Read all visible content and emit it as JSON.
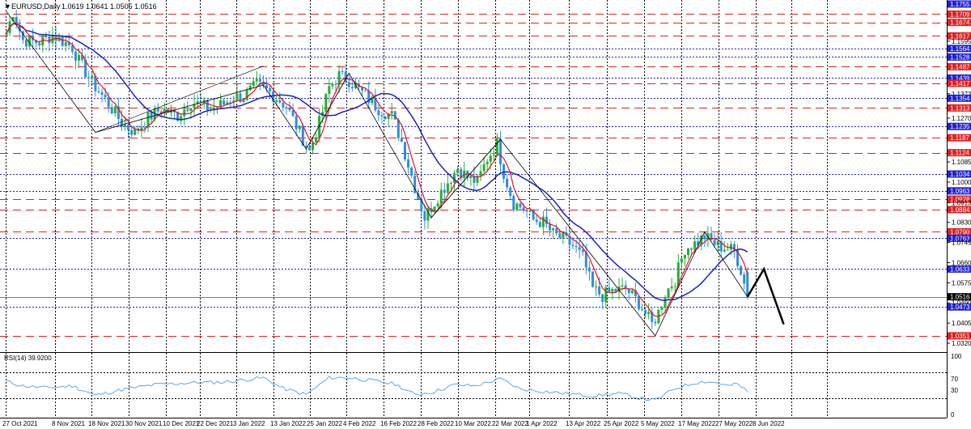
{
  "header": {
    "arrow": "▼",
    "title": "EURUSD,Daily",
    "ohlc": "1.0619 1.0641 1.0505 1.0516"
  },
  "rsi": {
    "label": "RSI(14) 39.9200",
    "levels": [
      "100",
      "70",
      "30",
      "0"
    ],
    "level_values": [
      70,
      30
    ]
  },
  "colors": {
    "bull": "#22b030",
    "bear": "#2e8fdc",
    "sma_fast": "#e8102a",
    "sma_slow": "#1a22c8",
    "rsi_line": "#5aa9e6",
    "support": "#2020d0",
    "resistance": "#e02020",
    "grid": "#000000"
  },
  "chart_data": {
    "type": "line",
    "title": "EURUSD,Daily",
    "y_axis_ticks": [
      "1.1755",
      "1.1709",
      "1.1674",
      "1.1617",
      "1.1595",
      "1.1564",
      "1.1528",
      "1.1487",
      "1.1439",
      "1.1417",
      "1.1373",
      "1.1354",
      "1.1313",
      "1.1270",
      "1.1235",
      "1.1187",
      "1.1124",
      "1.1085",
      "1.1034",
      "1.1000",
      "1.0963",
      "1.0928",
      "1.0913",
      "1.0884",
      "1.0830",
      "1.0790",
      "1.0763",
      "1.0745",
      "1.0660",
      "1.0633",
      "1.0575",
      "1.0516",
      "1.0490",
      "1.0473",
      "1.0405",
      "1.0351",
      "1.0320"
    ],
    "x_axis_ticks": [
      "27 Oct 2021",
      "8 Nov 2021",
      "18 Nov 2021",
      "30 Nov 2021",
      "10 Dec 2021",
      "22 Dec 2021",
      "3 Jan 2022",
      "13 Jan 2022",
      "25 Jan 2022",
      "4 Feb 2022",
      "16 Feb 2022",
      "28 Feb 2022",
      "10 Mar 2022",
      "22 Mar 2022",
      "1 Apr 2022",
      "13 Apr 2022",
      "25 Apr 2022",
      "5 May 2022",
      "17 May 2022",
      "27 May 2022",
      "8 Jun 2022"
    ],
    "ylim": [
      1.032,
      1.1755
    ],
    "support_levels": [
      {
        "value": "1.1564",
        "color": "#2020d0"
      },
      {
        "value": "1.1528",
        "color": "#2020d0"
      },
      {
        "value": "1.1439",
        "color": "#2020d0"
      },
      {
        "value": "1.1354",
        "color": "#2020d0"
      },
      {
        "value": "1.1235",
        "color": "#2020d0"
      },
      {
        "value": "1.1034",
        "color": "#2020d0"
      },
      {
        "value": "1.0963",
        "color": "#2020d0"
      },
      {
        "value": "1.0763",
        "color": "#2020d0"
      },
      {
        "value": "1.0633",
        "color": "#2020d0"
      },
      {
        "value": "1.0473",
        "color": "#2020d0"
      }
    ],
    "resistance_levels": [
      {
        "value": "1.1709",
        "color": "#e02020"
      },
      {
        "value": "1.1674",
        "color": "#e02020"
      },
      {
        "value": "1.1617",
        "color": "#e02020"
      },
      {
        "value": "1.1487",
        "color": "#e02020"
      },
      {
        "value": "1.1417",
        "color": "#e02020"
      },
      {
        "value": "1.1313",
        "color": "#e02020"
      },
      {
        "value": "1.1187",
        "color": "#e02020"
      },
      {
        "value": "1.1124",
        "color": "#e02020"
      },
      {
        "value": "1.0928",
        "color": "#e02020"
      },
      {
        "value": "1.0884",
        "color": "#e02020"
      },
      {
        "value": "1.0790",
        "color": "#e02020"
      },
      {
        "value": "1.0351",
        "color": "#e02020"
      }
    ],
    "current_price": {
      "value": "1.0516",
      "color": "#000000"
    },
    "price_waypoints": [
      [
        0,
        1.163
      ],
      [
        2,
        1.172
      ],
      [
        5,
        1.16
      ],
      [
        10,
        1.159
      ],
      [
        14,
        1.162
      ],
      [
        20,
        1.157
      ],
      [
        22,
        1.151
      ],
      [
        26,
        1.142
      ],
      [
        31,
        1.133
      ],
      [
        35,
        1.125
      ],
      [
        39,
        1.121
      ],
      [
        43,
        1.127
      ],
      [
        47,
        1.131
      ],
      [
        52,
        1.128
      ],
      [
        56,
        1.134
      ],
      [
        62,
        1.131
      ],
      [
        66,
        1.133
      ],
      [
        69,
        1.136
      ],
      [
        72,
        1.136
      ],
      [
        76,
        1.141
      ],
      [
        80,
        1.138
      ],
      [
        85,
        1.132
      ],
      [
        89,
        1.121
      ],
      [
        92,
        1.113
      ],
      [
        95,
        1.125
      ],
      [
        98,
        1.14
      ],
      [
        101,
        1.145
      ],
      [
        104,
        1.143
      ],
      [
        107,
        1.139
      ],
      [
        110,
        1.135
      ],
      [
        113,
        1.131
      ],
      [
        117,
        1.128
      ],
      [
        120,
        1.117
      ],
      [
        124,
        1.098
      ],
      [
        127,
        1.085
      ],
      [
        131,
        1.094
      ],
      [
        134,
        1.1
      ],
      [
        137,
        1.106
      ],
      [
        140,
        1.102
      ],
      [
        143,
        1.1
      ],
      [
        146,
        1.11
      ],
      [
        149,
        1.116
      ],
      [
        151,
        1.104
      ],
      [
        154,
        1.091
      ],
      [
        157,
        1.089
      ],
      [
        160,
        1.084
      ],
      [
        163,
        1.083
      ],
      [
        166,
        1.078
      ],
      [
        169,
        1.076
      ],
      [
        172,
        1.073
      ],
      [
        175,
        1.068
      ],
      [
        178,
        1.055
      ],
      [
        181,
        1.052
      ],
      [
        184,
        1.054
      ],
      [
        188,
        1.055
      ],
      [
        192,
        1.049
      ],
      [
        196,
        1.04
      ],
      [
        198,
        1.045
      ],
      [
        200,
        1.053
      ],
      [
        203,
        1.059
      ],
      [
        206,
        1.072
      ],
      [
        209,
        1.074
      ],
      [
        212,
        1.077
      ],
      [
        216,
        1.073
      ],
      [
        219,
        1.072
      ],
      [
        221,
        1.071
      ],
      [
        223,
        1.063
      ],
      [
        225,
        1.0516
      ]
    ],
    "series": [
      {
        "name": "price"
      },
      {
        "name": "fast moving average",
        "color": "#e8102a"
      },
      {
        "name": "slow moving average",
        "color": "#1a22c8"
      },
      {
        "name": "RSI(14)",
        "color": "#5aa9e6"
      }
    ],
    "zigzag": [
      [
        0,
        1.172
      ],
      [
        27,
        1.121
      ],
      [
        78,
        1.141
      ],
      [
        91,
        1.114
      ],
      [
        104,
        1.146
      ],
      [
        129,
        1.085
      ],
      [
        150,
        1.118
      ],
      [
        197,
        1.0351
      ],
      [
        212,
        1.079
      ],
      [
        225,
        1.0516
      ]
    ],
    "projection": [
      [
        225,
        1.0516
      ],
      [
        230,
        1.0633
      ],
      [
        236,
        1.04
      ]
    ],
    "rsi_values": [
      [
        0,
        56
      ],
      [
        5,
        49
      ],
      [
        12,
        46
      ],
      [
        20,
        49
      ],
      [
        27,
        34
      ],
      [
        35,
        43
      ],
      [
        45,
        51
      ],
      [
        56,
        54
      ],
      [
        66,
        55
      ],
      [
        78,
        62
      ],
      [
        84,
        45
      ],
      [
        91,
        35
      ],
      [
        98,
        62
      ],
      [
        104,
        62
      ],
      [
        110,
        58
      ],
      [
        118,
        52
      ],
      [
        124,
        35
      ],
      [
        130,
        40
      ],
      [
        136,
        51
      ],
      [
        142,
        49
      ],
      [
        150,
        60
      ],
      [
        156,
        44
      ],
      [
        164,
        40
      ],
      [
        172,
        36
      ],
      [
        178,
        33
      ],
      [
        186,
        37
      ],
      [
        192,
        30
      ],
      [
        197,
        26
      ],
      [
        203,
        45
      ],
      [
        209,
        54
      ],
      [
        212,
        56
      ],
      [
        216,
        54
      ],
      [
        219,
        49
      ],
      [
        222,
        52
      ],
      [
        225,
        40
      ]
    ]
  }
}
